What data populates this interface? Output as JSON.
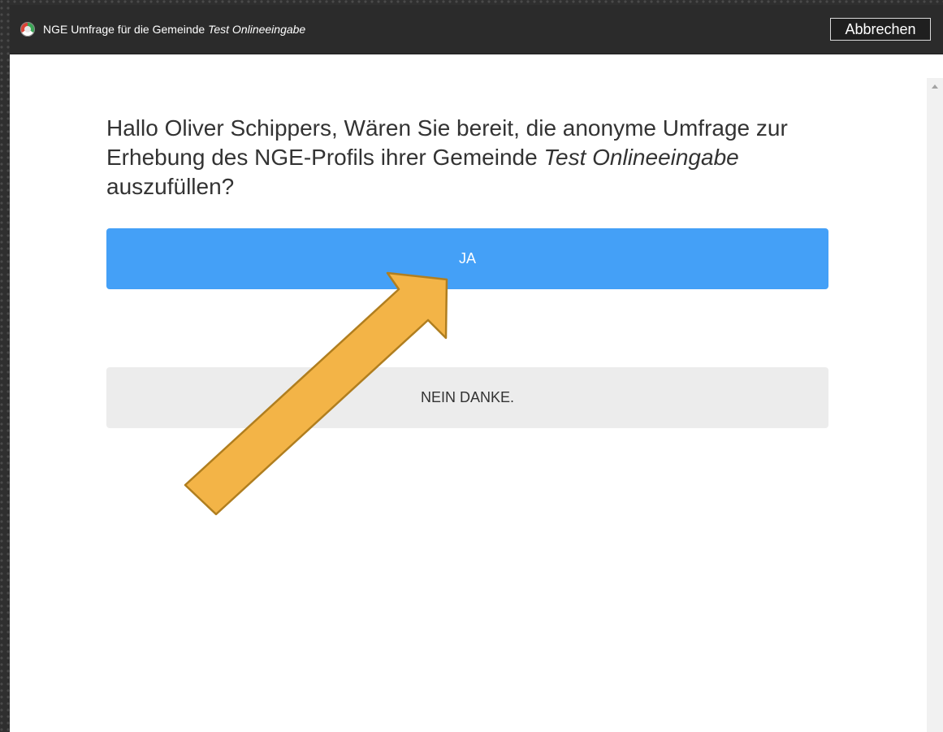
{
  "window": {
    "title_prefix": "NGE Umfrage für die Gemeinde",
    "title_community": "Test Onlineeingabe",
    "cancel_label": "Abbrechen"
  },
  "survey": {
    "question_part1": "Hallo Oliver Schippers, Wären Sie bereit, die anonyme Umfrage zur Erhebung des NGE-Profils ihrer Gemeinde",
    "question_community": "Test Onlineeingabe",
    "question_part2": "auszufüllen?",
    "yes_label": "JA",
    "no_label": "NEIN DANKE."
  },
  "annotation": {
    "arrow_color": "#f3b447",
    "arrow_outline": "#b07e1f",
    "arrow_icon": "pointer-arrow"
  },
  "colors": {
    "titlebar": "#2b2b2b",
    "yes_button": "#44a0f7",
    "no_button": "#ececec"
  }
}
